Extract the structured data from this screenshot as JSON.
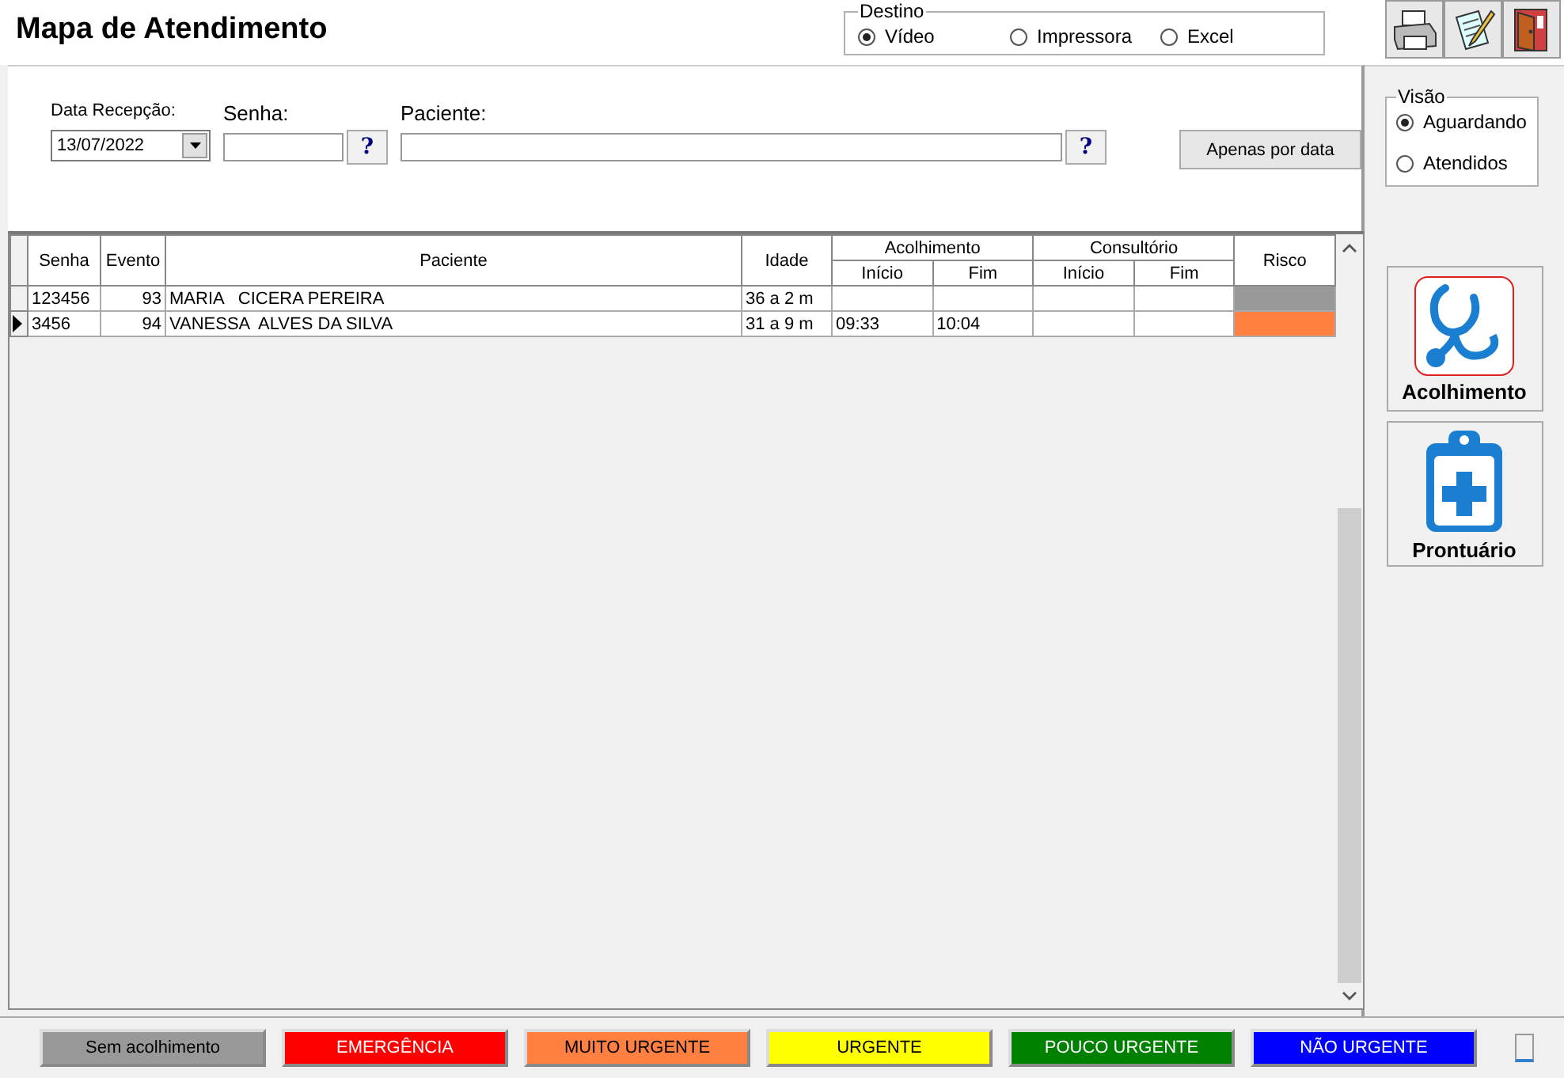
{
  "window": {
    "title": "Mapa de Atendimento"
  },
  "destino": {
    "legend": "Destino",
    "options": [
      {
        "label": "Vídeo",
        "selected": true
      },
      {
        "label": "Impressora",
        "selected": false
      },
      {
        "label": "Excel",
        "selected": false
      }
    ]
  },
  "filters": {
    "date_label": "Data Recepção:",
    "date_value": "13/07/2022",
    "senha_label": "Senha:",
    "paciente_label": "Paciente:",
    "help_buttons": [
      "?",
      "?"
    ],
    "only_date_button": "Apenas por data"
  },
  "visao": {
    "legend": "Visão",
    "options": [
      {
        "label": "Aguardando",
        "selected": true
      },
      {
        "label": "Atendidos",
        "selected": false
      }
    ]
  },
  "table": {
    "columns": [
      "Senha",
      "Evento",
      "Paciente",
      "Idade"
    ],
    "group_columns": [
      {
        "label": "Acolhimento",
        "sub": [
          "Início",
          "Fim"
        ]
      },
      {
        "label": "Consultório",
        "sub": [
          "Início",
          "Fim"
        ]
      }
    ],
    "risk_column": "Risco",
    "rows": [
      {
        "senha": "123456",
        "evento": "93",
        "paciente": "MARIA   CICERA PEREIRA",
        "idade": "36 a 2 m",
        "acolhimento_inicio": "",
        "acolhimento_fim": "",
        "selected": false,
        "color": "#999999"
      },
      {
        "senha": "3456",
        "evento": "94",
        "paciente": "VANESSA  ALVES DA SILVA",
        "idade": "31 a 9 m",
        "acolhimento_inicio": "09:33",
        "acolhimento_fim": "10:04",
        "selected": true,
        "color": "#ff8040"
      }
    ]
  },
  "side_buttons": [
    {
      "label": "Acolhimento",
      "kind": "stethoscope"
    },
    {
      "label": "Prontuário",
      "kind": "clipboard"
    }
  ],
  "legend": [
    {
      "label": "Sem acolhimento",
      "color": "#999999"
    },
    {
      "label": "EMERGÊNCIA",
      "color": "#ff0000"
    },
    {
      "label": "MUITO URGENTE",
      "color": "#ff8040"
    },
    {
      "label": "URGENTE",
      "color": "#ffff00"
    },
    {
      "label": "POUCO URGENTE",
      "color": "#008000"
    },
    {
      "label": "NÃO URGENTE",
      "color": "#0000ff"
    }
  ]
}
